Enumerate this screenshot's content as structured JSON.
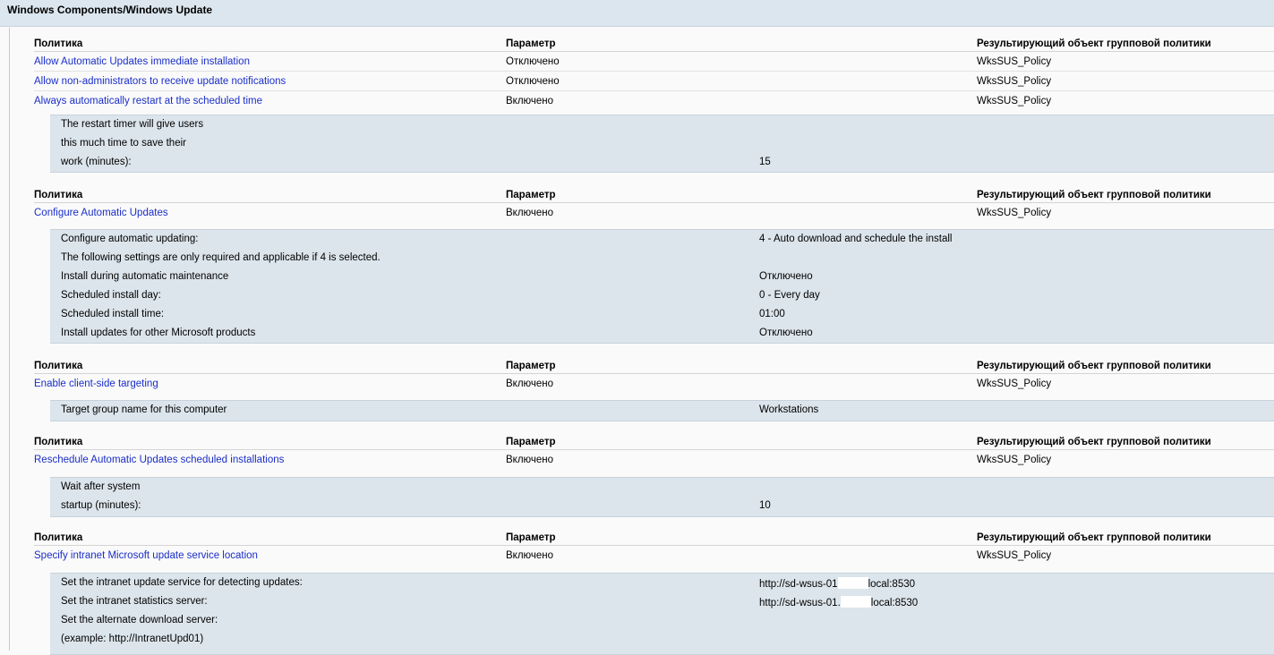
{
  "section": {
    "title": "Windows Components/Windows Update"
  },
  "columns": {
    "policy": "Политика",
    "setting": "Параметр",
    "gpo": "Результирующий объект групповой политики"
  },
  "blocks": [
    {
      "policies": [
        {
          "name": "Allow Automatic Updates immediate installation",
          "state": "Отключено",
          "gpo": "WksSUS_Policy"
        },
        {
          "name": "Allow non-administrators to receive update notifications",
          "state": "Отключено",
          "gpo": "WksSUS_Policy"
        },
        {
          "name": "Always automatically restart at the scheduled time",
          "state": "Включено",
          "gpo": "WksSUS_Policy"
        }
      ],
      "settings": [
        {
          "name": "The restart timer will give users",
          "value": ""
        },
        {
          "name": "this much time to save their",
          "value": ""
        },
        {
          "name": "work (minutes):",
          "value": "15"
        }
      ]
    },
    {
      "policies": [
        {
          "name": "Configure Automatic Updates",
          "state": "Включено",
          "gpo": "WksSUS_Policy"
        }
      ],
      "settings": [
        {
          "name": "Configure automatic updating:",
          "value": "4 - Auto download and schedule the install"
        },
        {
          "name": "The following settings are only required and applicable if 4 is selected.",
          "value": ""
        },
        {
          "name": "Install during automatic maintenance",
          "value": "Отключено"
        },
        {
          "name": "Scheduled install day:",
          "value": "0 - Every day"
        },
        {
          "name": "Scheduled install time:",
          "value": "01:00"
        },
        {
          "name": "Install updates for other Microsoft products",
          "value": "Отключено"
        }
      ]
    },
    {
      "policies": [
        {
          "name": "Enable client-side targeting",
          "state": "Включено",
          "gpo": "WksSUS_Policy"
        }
      ],
      "settings": [
        {
          "name": "Target group name for this computer",
          "value": "Workstations"
        }
      ]
    },
    {
      "policies": [
        {
          "name": "Reschedule Automatic Updates scheduled installations",
          "state": "Включено",
          "gpo": "WksSUS_Policy"
        }
      ],
      "settings": [
        {
          "name": "Wait after system",
          "value": ""
        },
        {
          "name": "startup (minutes):",
          "value": "10"
        }
      ]
    },
    {
      "policies": [
        {
          "name": "Specify intranet Microsoft update service location",
          "state": "Включено",
          "gpo": "WksSUS_Policy"
        }
      ],
      "settings": [
        {
          "name": "Set the intranet update service for detecting updates:",
          "value_pre": "http://sd-wsus-01",
          "value_post": "local:8530"
        },
        {
          "name": "Set the intranet statistics server:",
          "value_pre": "http://sd-wsus-01.",
          "value_post": "local:8530"
        },
        {
          "name": "Set the alternate download server:",
          "value": ""
        },
        {
          "name": "(example: http://IntranetUpd01)",
          "value": ""
        }
      ]
    }
  ]
}
